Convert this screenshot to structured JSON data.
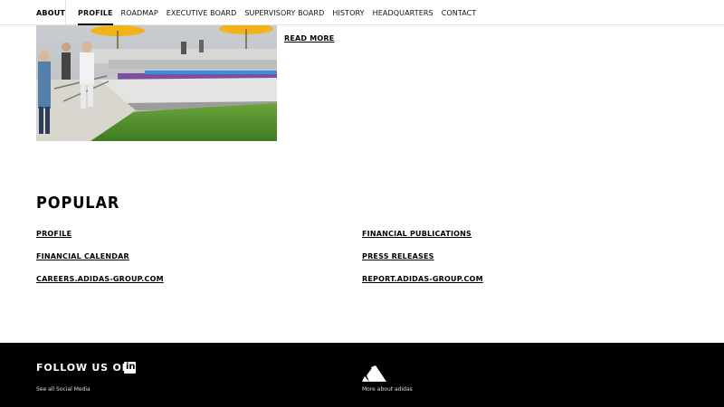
{
  "nav": {
    "section": "ABOUT",
    "items": [
      {
        "label": "PROFILE",
        "active": true
      },
      {
        "label": "ROADMAP"
      },
      {
        "label": "EXECUTIVE BOARD"
      },
      {
        "label": "SUPERVISORY BOARD"
      },
      {
        "label": "HISTORY"
      },
      {
        "label": "HEADQUARTERS"
      },
      {
        "label": "CONTACT"
      }
    ]
  },
  "article": {
    "read_more": "READ MORE"
  },
  "popular": {
    "title": "POPULAR",
    "links": [
      "PROFILE",
      "FINANCIAL CALENDAR",
      "CAREERS.ADIDAS-GROUP.COM",
      "FINANCIAL PUBLICATIONS",
      "PRESS RELEASES",
      "REPORT.ADIDAS-GROUP.COM"
    ]
  },
  "footer": {
    "follow": "FOLLOW US ON",
    "social_icon": "linkedin-icon",
    "see_all": "See all Social Media",
    "logo_icon": "adidas-logo-icon",
    "more_about": "More about adidas"
  }
}
